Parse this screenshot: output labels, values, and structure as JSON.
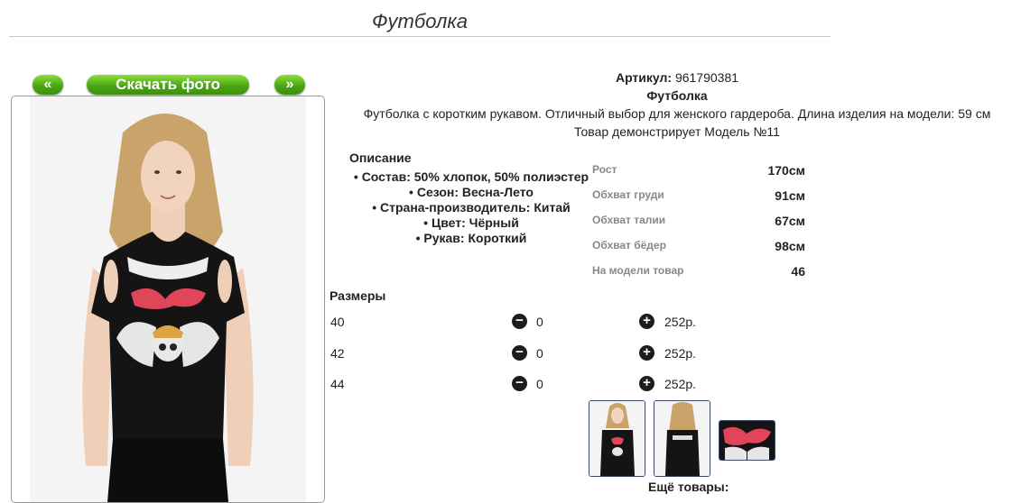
{
  "page": {
    "title": "Футболка"
  },
  "gallery": {
    "prev_label": "«",
    "download_label": "Скачать фото",
    "next_label": "»"
  },
  "product": {
    "article_label": "Артикул:",
    "article_value": "961790381",
    "name": "Футболка",
    "description": "Футболка с коротким рукавом. Отличный выбор для женского гардероба. Длина изделия на модели: 59 см",
    "model_note": "Товар демонстрирует Модель №11"
  },
  "description": {
    "title": "Описание",
    "items": [
      "Состав: 50% хлопок, 50% полиэстер",
      "Сезон: Весна-Лето",
      "Страна-производитель: Китай",
      "Цвет: Чёрный",
      "Рукав: Короткий"
    ]
  },
  "model_params": [
    {
      "label": "Рост",
      "value": "170см"
    },
    {
      "label": "Обхват груди",
      "value": "91см"
    },
    {
      "label": "Обхват талии",
      "value": "67см"
    },
    {
      "label": "Обхват бёдер",
      "value": "98см"
    },
    {
      "label": "На модели товар",
      "value": "46"
    }
  ],
  "sizes": {
    "title": "Размеры",
    "rows": [
      {
        "size": "40",
        "qty": "0",
        "price": "252р."
      },
      {
        "size": "42",
        "qty": "0",
        "price": "252р."
      },
      {
        "size": "44",
        "qty": "0",
        "price": "252р."
      }
    ]
  },
  "more": {
    "label": "Ещё товары:"
  },
  "icons": {
    "minus": "minus-circle-icon",
    "plus": "plus-circle-icon"
  },
  "colors": {
    "button_green": "#4aa614",
    "print_red": "#e0455a",
    "garment": "#141414"
  }
}
